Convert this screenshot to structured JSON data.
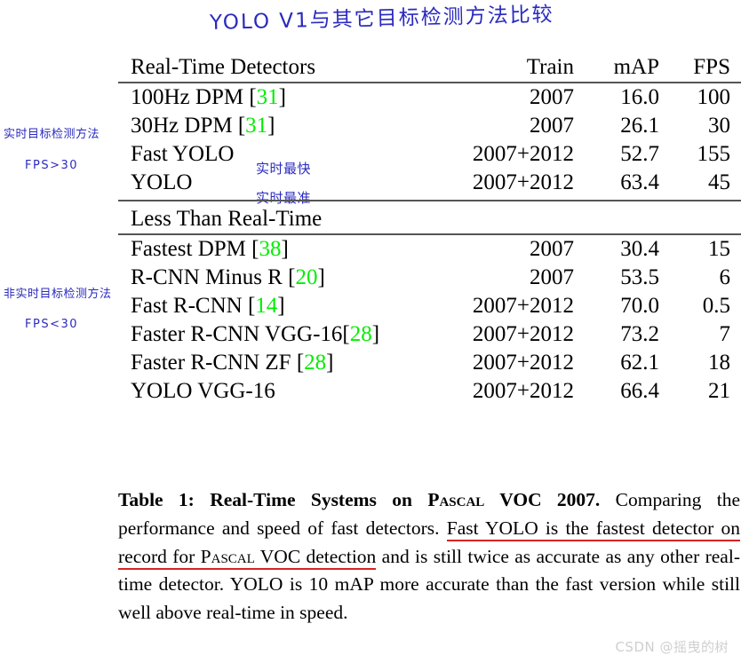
{
  "handwritten": {
    "title": "YOLO V1与其它目标检测方法比较",
    "realtime_label": "实时目标检测方法",
    "realtime_fps": "FPS>30",
    "nonrealtime_label": "非实时目标检测方法",
    "nonrealtime_fps": "FPS<30",
    "fast_yolo_note": "实时最快",
    "yolo_note": "实时最准",
    "ink_color": "#2A2ABF"
  },
  "table": {
    "columns": {
      "name": "Real-Time Detectors",
      "train": "Train",
      "map": "mAP",
      "fps": "FPS"
    },
    "section2_title": "Less Than Real-Time",
    "cite_color": "#00EE00",
    "rows_realtime": [
      {
        "name": "100Hz DPM",
        "cite": "31",
        "train": "2007",
        "map": "16.0",
        "fps": "100",
        "map_bold": false,
        "fps_bold": false
      },
      {
        "name": "30Hz DPM",
        "cite": "31",
        "train": "2007",
        "map": "26.1",
        "fps": "30",
        "map_bold": false,
        "fps_bold": false
      },
      {
        "name": "Fast YOLO",
        "cite": "",
        "train": "2007+2012",
        "map": "52.7",
        "fps": "155",
        "map_bold": false,
        "fps_bold": true
      },
      {
        "name": "YOLO",
        "cite": "",
        "train": "2007+2012",
        "map": "63.4",
        "fps": "45",
        "map_bold": true,
        "fps_bold": false
      }
    ],
    "rows_slower": [
      {
        "name": "Fastest DPM",
        "cite": "38",
        "train": "2007",
        "map": "30.4",
        "fps": "15"
      },
      {
        "name": "R-CNN Minus R",
        "cite": "20",
        "train": "2007",
        "map": "53.5",
        "fps": "6"
      },
      {
        "name": "Fast R-CNN",
        "cite": "14",
        "train": "2007+2012",
        "map": "70.0",
        "fps": "0.5"
      },
      {
        "name": "Faster R-CNN VGG-16",
        "cite": "28",
        "train": "2007+2012",
        "map": "73.2",
        "fps": "7"
      },
      {
        "name": "Faster R-CNN ZF",
        "cite": "28",
        "train": "2007+2012",
        "map": "62.1",
        "fps": "18"
      },
      {
        "name": "YOLO VGG-16",
        "cite": "",
        "train": "2007+2012",
        "map": "66.4",
        "fps": "21"
      }
    ]
  },
  "caption": {
    "label": "Table 1:",
    "bold_title_a": "Real-Time Systems on ",
    "bold_title_smallcaps": "Pascal",
    "bold_title_b": " VOC 2007.",
    "body_1": " Comparing the performance and speed of fast detectors. ",
    "underlined_a": "Fast YOLO is the fastest detector on record for ",
    "underlined_smallcaps": "Pascal",
    "underlined_b": " VOC detection",
    "body_2": " and is still twice as accurate as any other real-time detector. YOLO is 10 mAP more accurate than the fast version while still well above real-time in speed.",
    "underline_color": "#D42424"
  },
  "watermark": "CSDN @摇曳的树"
}
